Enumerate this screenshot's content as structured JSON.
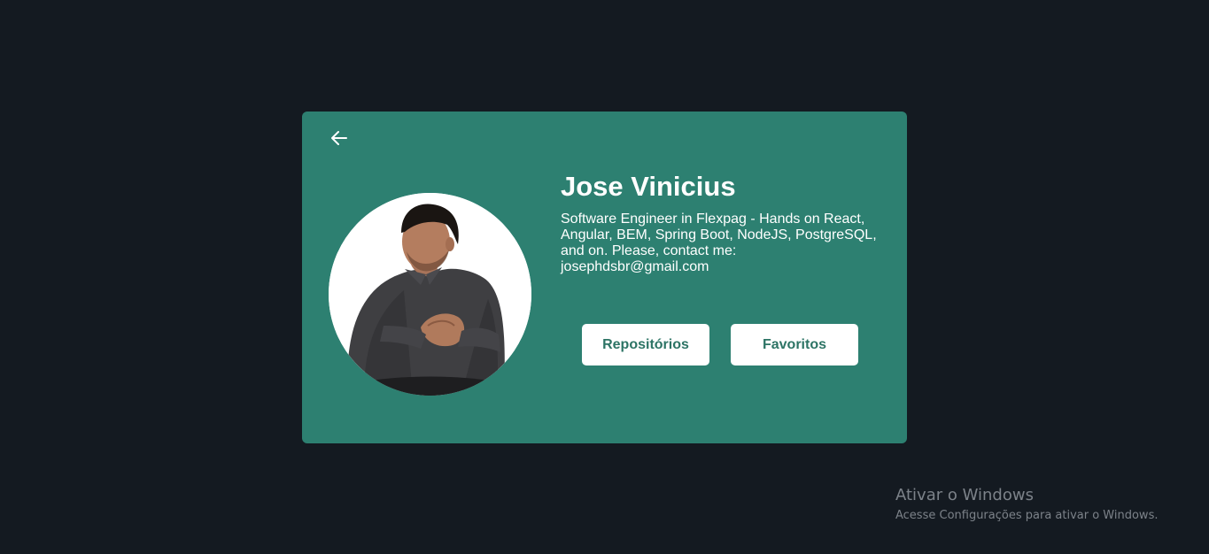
{
  "profile": {
    "name": "Jose Vinicius",
    "bio": "Software Engineer in Flexpag - Hands on React, Angular, BEM, Spring Boot, NodeJS, PostgreSQL, and on. Please, contact me: josephdsbr@gmail.com",
    "avatar_icon": "user-photo"
  },
  "navigation": {
    "back_icon": "arrow-left-icon"
  },
  "actions": {
    "repositories_label": "Repositórios",
    "favorites_label": "Favoritos"
  },
  "watermark": {
    "title": "Ativar o Windows",
    "subtitle": "Acesse Configurações para ativar o Windows."
  },
  "colors": {
    "background": "#141a21",
    "card": "#2d8071",
    "button_text": "#2d7465",
    "button_bg": "#ffffff"
  }
}
